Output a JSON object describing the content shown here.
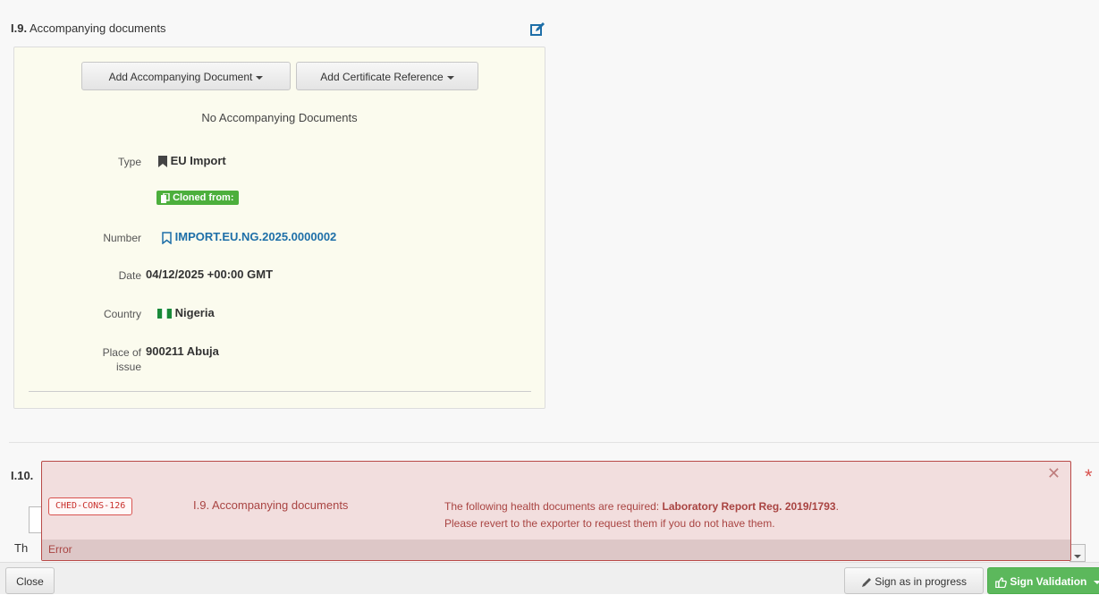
{
  "section_i9": {
    "number": "I.9.",
    "title": "Accompanying documents",
    "add_document_label": "Add Accompanying Document",
    "add_certificate_label": "Add Certificate Reference",
    "no_documents_text": "No Accompanying Documents",
    "type_label": "Type",
    "type_value": "EU Import",
    "cloned_badge": "Cloned from:",
    "number_label": "Number",
    "number_value": "IMPORT.EU.NG.2025.0000002",
    "date_label": "Date",
    "date_value": "04/12/2025 +00:00 GMT",
    "country_label": "Country",
    "country_value": "Nigeria",
    "place_label_line1": "Place of",
    "place_label_line2": "issue",
    "place_value": "900211 Abuja"
  },
  "section_i10": {
    "title": "I.10.",
    "partial_text": "Th"
  },
  "error": {
    "code": "CHED-CONS-126",
    "section": "I.9. Accompanying documents",
    "message_prefix": "The following health documents are required: ",
    "message_bold": "Laboratory Report Reg. 2019/1793",
    "message_suffix": ".",
    "message_line2": "Please revert to the exporter to request them if you do not have them.",
    "footer_label": "Error"
  },
  "footer": {
    "close_label": "Close",
    "sign_progress_label": "Sign as in progress",
    "sign_validation_label": "Sign Validation"
  },
  "colors": {
    "accent_link": "#1e6fa8",
    "success": "#5cb85c",
    "error": "#a94442",
    "nigeria_green": "#1a8a3a"
  }
}
